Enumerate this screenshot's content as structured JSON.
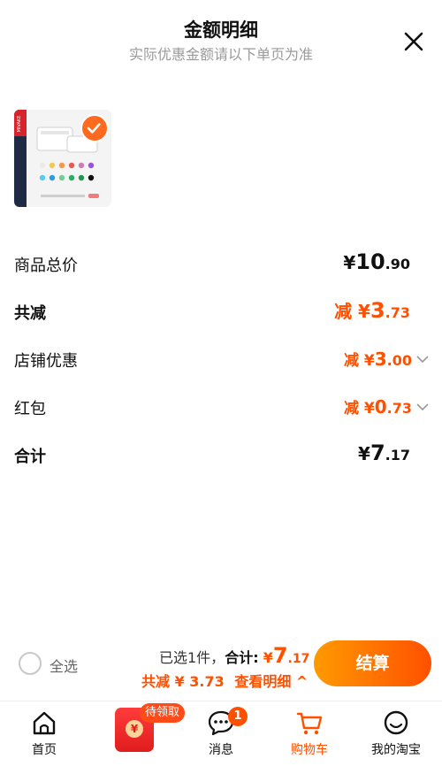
{
  "header": {
    "title": "金额明细",
    "subtitle": "实际优惠金额请以下单页为准"
  },
  "product": {
    "brand_text": "MIVAKE",
    "selected": true
  },
  "rows": [
    {
      "label": "商品总价",
      "prefix": "",
      "yen": "¥",
      "int": "10",
      "dec": ".90",
      "has_arrow": false
    },
    {
      "label": "共减",
      "prefix": "减 ",
      "yen": "¥",
      "int": "3",
      "dec": ".73",
      "has_arrow": false
    },
    {
      "label": "店铺优惠",
      "prefix": "减 ",
      "yen": "¥",
      "int": "3",
      "dec": ".00",
      "has_arrow": true
    },
    {
      "label": "红包",
      "prefix": "减 ",
      "yen": "¥",
      "int": "0",
      "dec": ".73",
      "has_arrow": true
    },
    {
      "label": "合计",
      "prefix": "",
      "yen": "¥",
      "int": "7",
      "dec": ".17",
      "has_arrow": false
    }
  ],
  "bottom": {
    "select_all": "全选",
    "selected_text": "已选1件，",
    "total_label": "合计:",
    "total_yen": "¥",
    "total_int": "7",
    "total_dec": ".17",
    "discount_text": "共减 ¥ 3.73",
    "detail_link": "查看明细 ^",
    "checkout": "结算"
  },
  "tabbar": {
    "tabs": [
      {
        "label": "首页",
        "icon": "home-icon"
      },
      {
        "label": "",
        "icon": "red-packet-icon"
      },
      {
        "label": "消息",
        "icon": "message-icon"
      },
      {
        "label": "购物车",
        "icon": "cart-icon"
      },
      {
        "label": "我的淘宝",
        "icon": "profile-icon"
      }
    ],
    "redpacket_badge": "待领取",
    "redpacket_coin": "¥",
    "message_badge": "1"
  },
  "colors": {
    "accent": "#ff5000",
    "checkout_start": "#ff9a00",
    "checkout_end": "#ff5000"
  }
}
